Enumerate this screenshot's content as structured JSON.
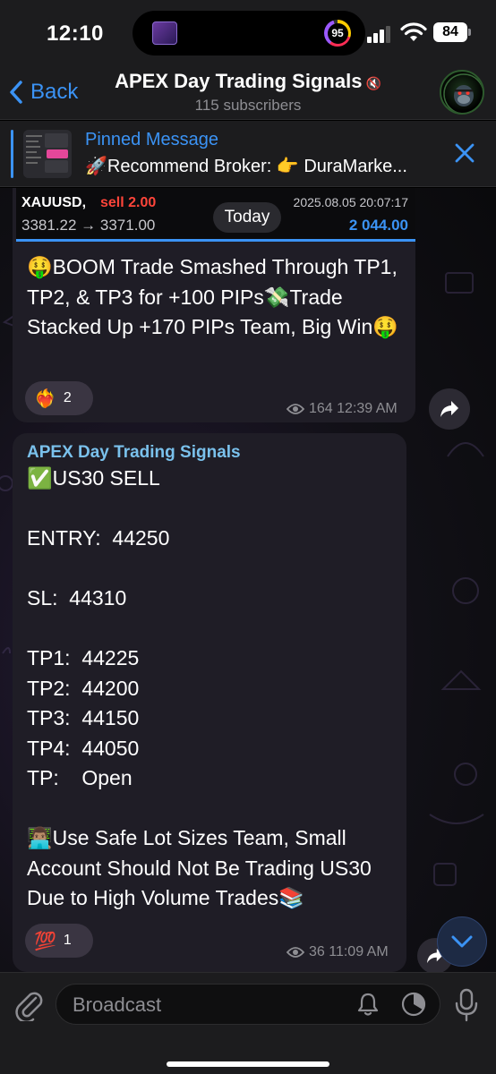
{
  "status_bar": {
    "time": "12:10",
    "ring_value": "95",
    "battery": "84"
  },
  "header": {
    "back_label": "Back",
    "channel_title": "APEX Day Trading Signals",
    "mute_icon": "🔇",
    "subscribers": "115 subscribers"
  },
  "pinned": {
    "label": "Pinned Message",
    "text": "🚀Recommend Broker: 👉 DuraMarke..."
  },
  "chat": {
    "date_pill": "Today",
    "message1": {
      "trade_image": {
        "symbol": "XAUUSD,",
        "side": "sell 2.00",
        "price": "3381.22 → 3371.00",
        "datetime": "2025.08.05 20:07:17",
        "amount": "2 044.00"
      },
      "text": "🤑BOOM Trade Smashed Through TP1, TP2, & TP3 for +100 PIPs💸Trade Stacked Up +170 PIPs Team, Big Win🤑",
      "reaction": {
        "emoji": "❤️‍🔥",
        "count": "2"
      },
      "views": "164",
      "time": "12:39 AM"
    },
    "message2": {
      "channel_name": "APEX Day Trading Signals",
      "text": "✅US30 SELL\n\nENTRY:  44250\n\nSL:  44310\n\nTP1:  44225\nTP2:  44200\nTP3:  44150\nTP4:  44050\nTP:    Open\n\n👨🏽‍💻Use Safe Lot Sizes Team, Small Account Should Not Be Trading US30 Due to High Volume Trades📚",
      "reaction": {
        "emoji": "💯",
        "count": "1"
      },
      "views": "36",
      "time": "11:09 AM"
    }
  },
  "input": {
    "placeholder": "Broadcast"
  },
  "colors": {
    "accent": "#3b93f5",
    "channel_name": "#7ac1ec",
    "sell_red": "#ff453a"
  }
}
